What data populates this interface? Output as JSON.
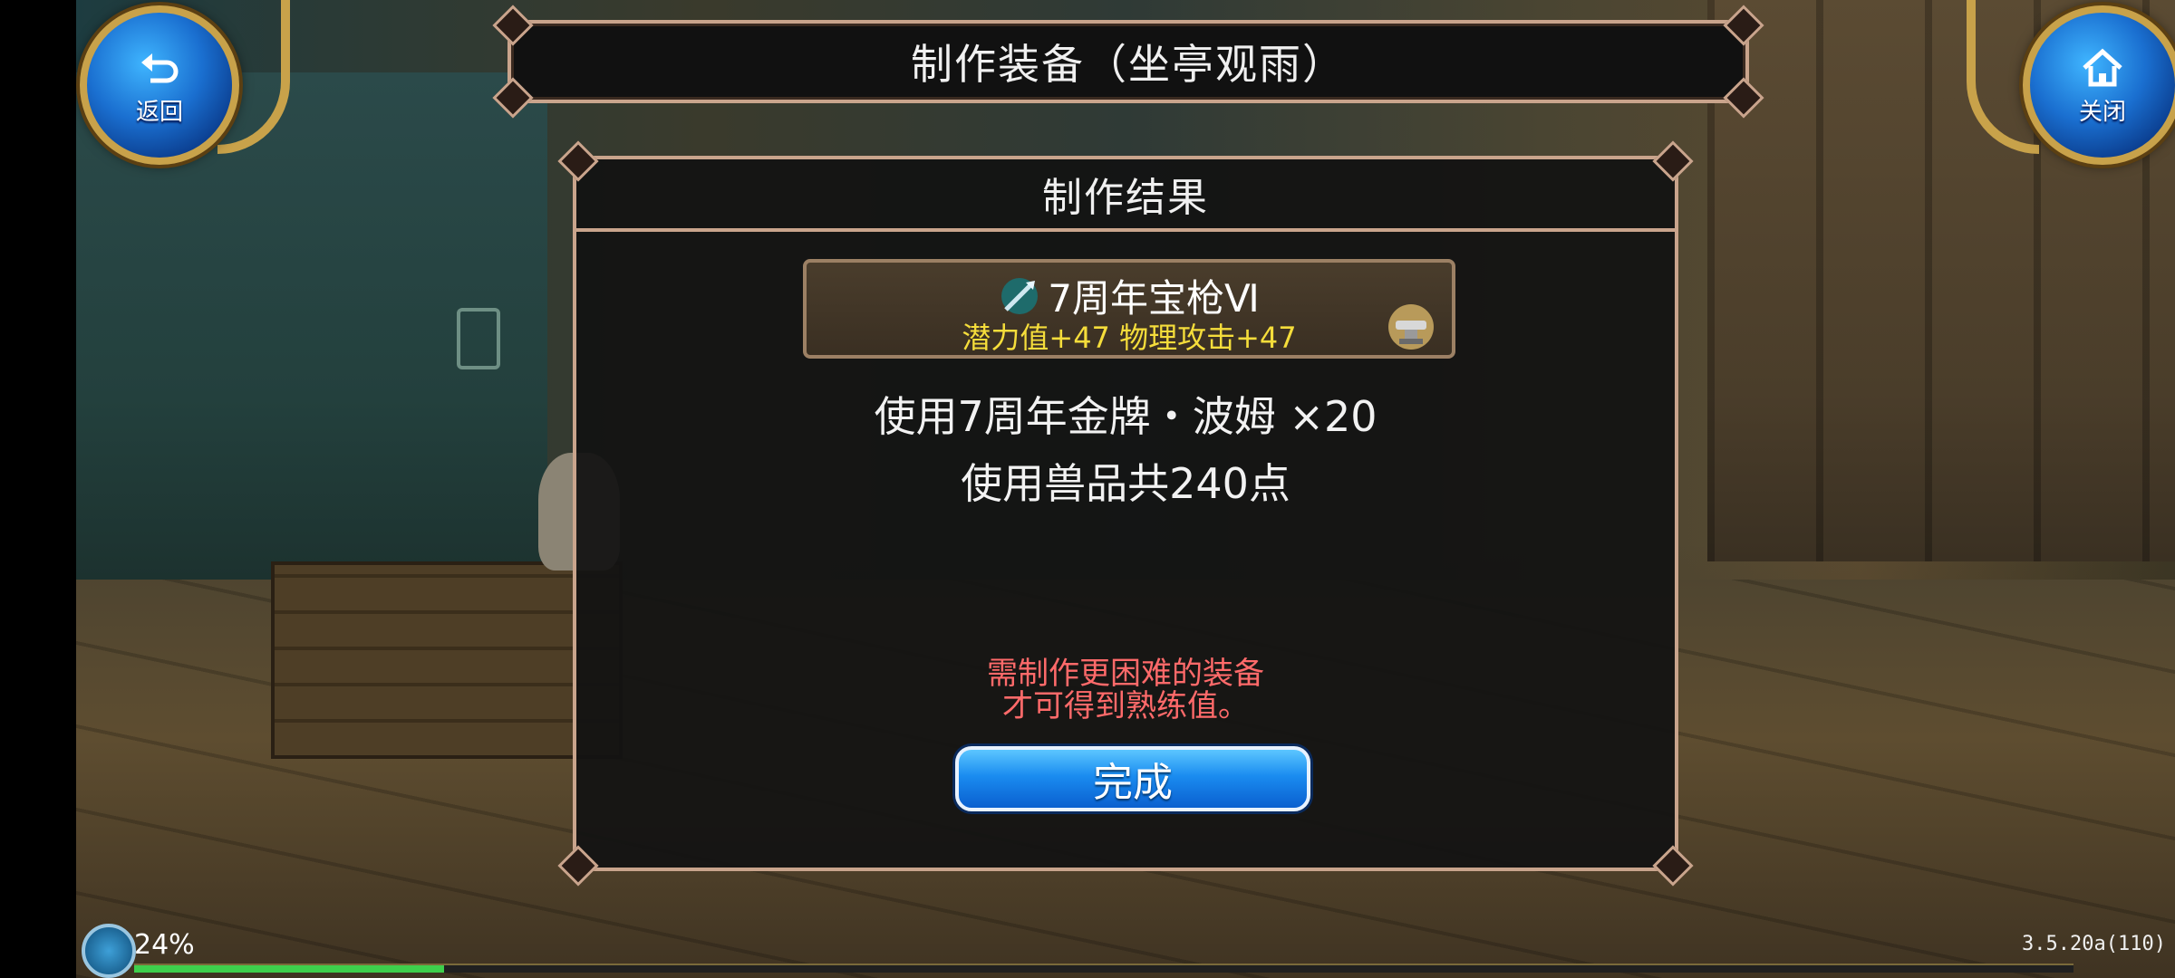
{
  "header": {
    "title": "制作装备（坐亭观雨）"
  },
  "nav": {
    "back_label": "返回",
    "close_label": "关闭"
  },
  "result": {
    "title": "制作结果",
    "item": {
      "name": "7周年宝枪Ⅵ",
      "stats": "潜力值+47  物理攻击+47",
      "icon": "spear-icon"
    },
    "material_line": "使用7周年金牌・波姆 ×20",
    "points_line": "使用兽品共240点",
    "warning_line1": "需制作更困难的装备",
    "warning_line2": "才可得到熟练值。",
    "done_label": "完成"
  },
  "hud": {
    "exp_percent_text": "24%",
    "exp_progress": 0.16,
    "version": "3.5.20a(110)"
  },
  "colors": {
    "frame": "#c9a48c",
    "stat_yellow": "#f5dd3b",
    "warning_red": "#ff6a6a",
    "button_blue": "#1a8cf0"
  }
}
